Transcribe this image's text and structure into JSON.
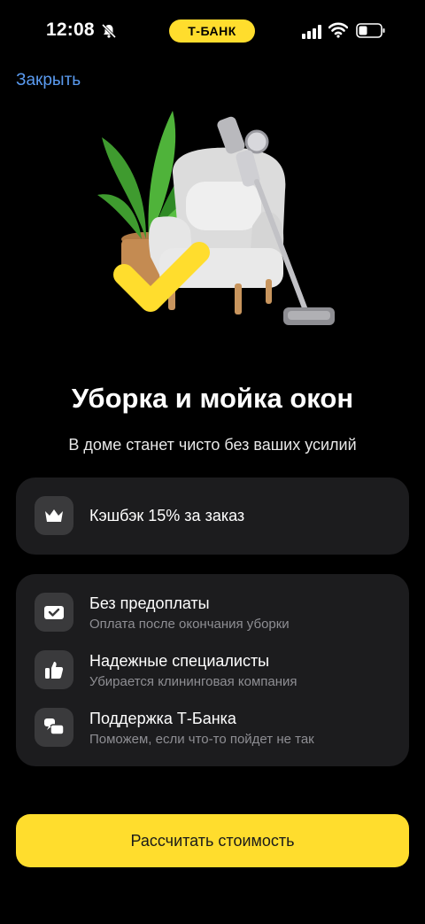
{
  "status_bar": {
    "time": "12:08",
    "bank_pill": "Т-БАНК",
    "accent_color": "#FFDD2D"
  },
  "header": {
    "close_label": "Закрыть",
    "link_color": "#5a9bf0"
  },
  "hero": {
    "illustration": "armchair-plant-vacuum-illustration"
  },
  "main": {
    "title": "Уборка и мойка окон",
    "subtitle": "В доме станет чисто без ваших усилий"
  },
  "cashback_card": {
    "icon": "crown-icon",
    "label": "Кэшбэк 15% за заказ"
  },
  "benefits": [
    {
      "icon": "wallet-check-icon",
      "title": "Без предоплаты",
      "subtitle": "Оплата после окончания уборки"
    },
    {
      "icon": "thumbs-up-icon",
      "title": "Надежные специалисты",
      "subtitle": "Убирается клининговая компания"
    },
    {
      "icon": "chat-bubbles-icon",
      "title": "Поддержка Т-Банка",
      "subtitle": "Поможем, если что-то пойдет не так"
    }
  ],
  "cta": {
    "label": "Рассчитать стоимость",
    "color": "#FFDD2D"
  }
}
